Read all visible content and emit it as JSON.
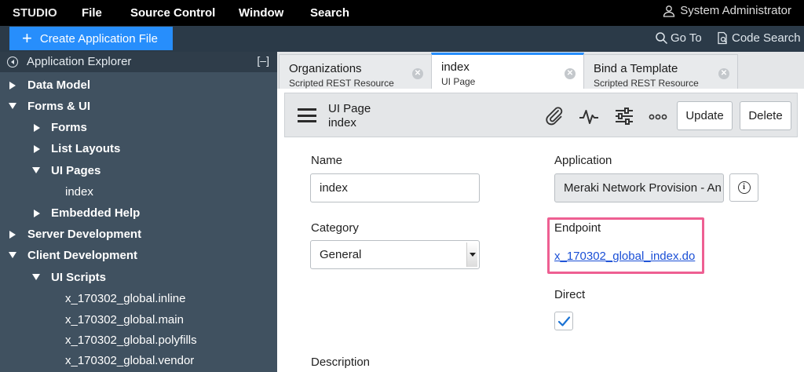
{
  "menubar": {
    "brand": "STUDIO",
    "items": [
      "File",
      "Source Control",
      "Window",
      "Search"
    ],
    "user": "System Administrator"
  },
  "toolbar": {
    "create_label": "Create Application File",
    "goto_label": "Go To",
    "code_search_label": "Code Search"
  },
  "sidebar": {
    "title": "Application Explorer",
    "collapse_label": "[–]",
    "items": [
      {
        "label": "Data Model",
        "expanded": false
      },
      {
        "label": "Forms & UI",
        "expanded": true
      },
      {
        "label": "Forms",
        "expanded": false
      },
      {
        "label": "List Layouts",
        "expanded": false
      },
      {
        "label": "UI Pages",
        "expanded": true
      },
      {
        "label": "index"
      },
      {
        "label": "Embedded Help",
        "expanded": false
      },
      {
        "label": "Server Development",
        "expanded": false
      },
      {
        "label": "Client Development",
        "expanded": true
      },
      {
        "label": "UI Scripts",
        "expanded": true
      },
      {
        "label": "x_170302_global.inline"
      },
      {
        "label": "x_170302_global.main"
      },
      {
        "label": "x_170302_global.polyfills"
      },
      {
        "label": "x_170302_global.vendor"
      }
    ]
  },
  "tabs": [
    {
      "title": "Organizations",
      "subtitle": "Scripted REST Resource",
      "active": false
    },
    {
      "title": "index",
      "subtitle": "UI Page",
      "active": true
    },
    {
      "title": "Bind a Template",
      "subtitle": "Scripted REST Resource",
      "active": false
    }
  ],
  "form_header": {
    "title": "UI Page",
    "subtitle": "index",
    "update_label": "Update",
    "delete_label": "Delete"
  },
  "form": {
    "name_label": "Name",
    "name_value": "index",
    "application_label": "Application",
    "application_value": "Meraki Network Provision - An",
    "category_label": "Category",
    "category_value": "General",
    "endpoint_label": "Endpoint",
    "endpoint_value": "x_170302_global_index.do",
    "direct_label": "Direct",
    "direct_checked": true,
    "description_label": "Description"
  },
  "colors": {
    "accent": "#278efc",
    "highlight": "#ee5f92",
    "sidebar_bg": "#405160"
  }
}
